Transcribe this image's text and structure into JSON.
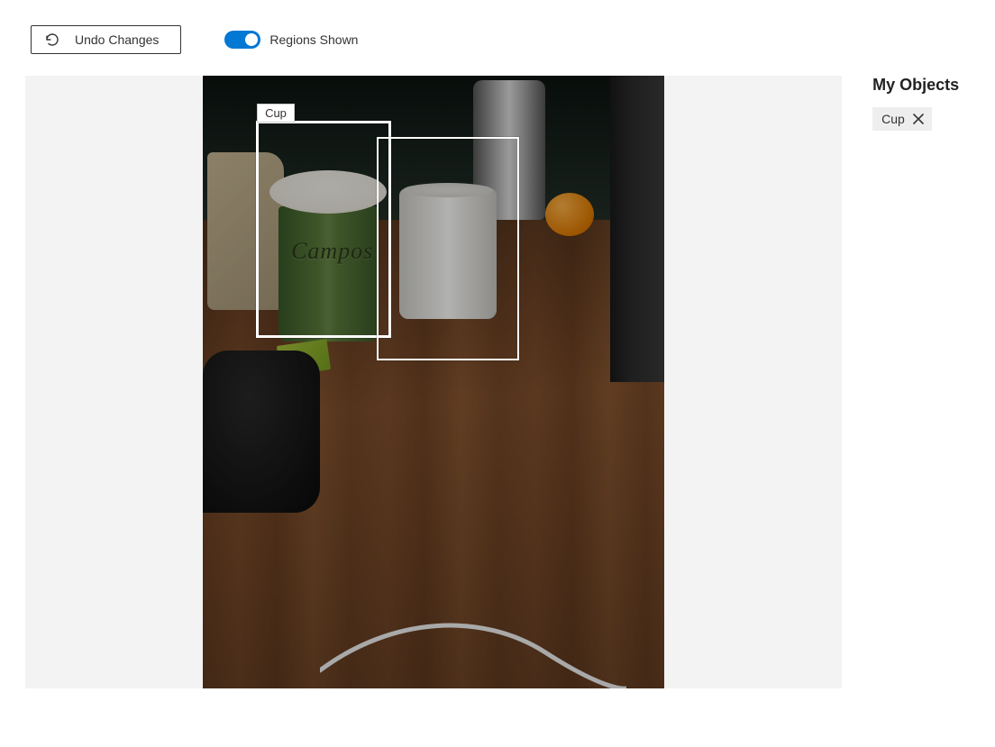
{
  "toolbar": {
    "undo_label": "Undo Changes",
    "toggle_label": "Regions Shown",
    "toggle_on": true
  },
  "image": {
    "cup_brand_text": "Campos"
  },
  "regions": [
    {
      "label": "Cup",
      "selected": true
    },
    {
      "label": "",
      "selected": false
    }
  ],
  "sidebar": {
    "title": "My Objects",
    "objects": [
      {
        "label": "Cup"
      }
    ]
  }
}
